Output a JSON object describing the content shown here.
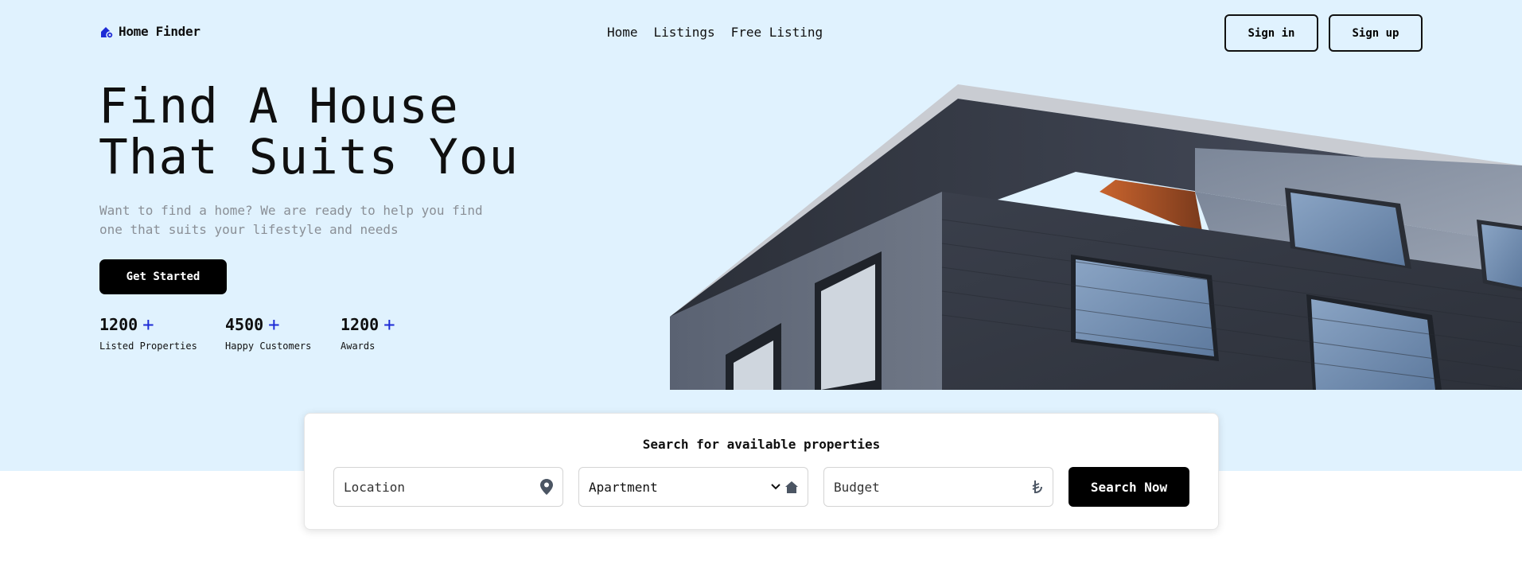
{
  "brand": {
    "name": "Home Finder",
    "icon": "house-icon",
    "color": "#1d2bd6"
  },
  "nav": {
    "items": [
      {
        "label": "Home"
      },
      {
        "label": "Listings"
      },
      {
        "label": "Free Listing"
      }
    ]
  },
  "auth": {
    "signin": "Sign in",
    "signup": "Sign up"
  },
  "hero": {
    "title_line1": "Find A House",
    "title_line2": "That Suits You",
    "subtitle_line1": "Want to find a home? We are ready to help you find",
    "subtitle_line2": "one that suits your lifestyle and needs",
    "cta": "Get Started",
    "background": "#e0f2fe"
  },
  "stats": [
    {
      "value": "1200",
      "plus": "+",
      "label": "Listed Properties"
    },
    {
      "value": "4500",
      "plus": "+",
      "label": "Happy Customers"
    },
    {
      "value": "1200",
      "plus": "+",
      "label": "Awards"
    }
  ],
  "search": {
    "title": "Search for available properties",
    "location_placeholder": "Location",
    "type_value": "Apartment",
    "budget_placeholder": "Budget",
    "button": "Search Now",
    "icons": {
      "location": "map-pin-icon",
      "type": "home-icon",
      "budget": "lira-icon",
      "dropdown": "chevron-down-icon"
    }
  }
}
